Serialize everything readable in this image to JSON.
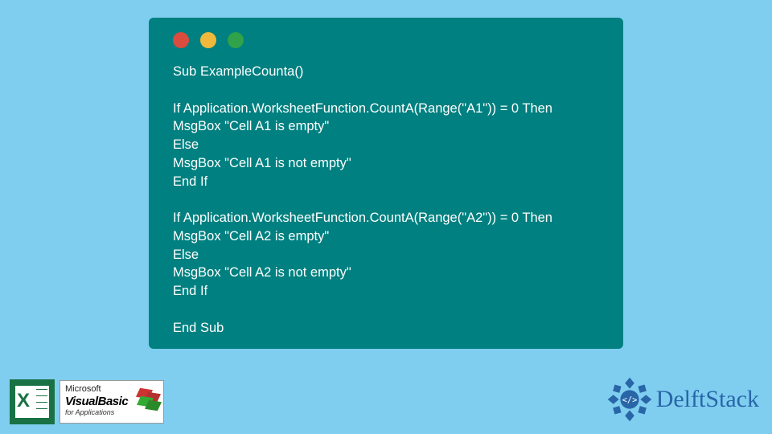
{
  "code": {
    "lines": [
      "Sub ExampleCounta()",
      "",
      "If Application.WorksheetFunction.CountA(Range(\"A1\")) = 0 Then",
      "MsgBox \"Cell A1 is empty\"",
      "Else",
      "MsgBox \"Cell A1 is not empty\"",
      "End If",
      "",
      "If Application.WorksheetFunction.CountA(Range(\"A2\")) = 0 Then",
      "MsgBox \"Cell A2 is empty\"",
      "Else",
      "MsgBox \"Cell A2 is not empty\"",
      "End If",
      "",
      "End Sub"
    ]
  },
  "vb_badge": {
    "line1": "Microsoft",
    "line2": "VisualBasic",
    "line3": "for Applications"
  },
  "brand": {
    "name": "DelftStack"
  },
  "colors": {
    "background": "#7fcef0",
    "window": "#008080",
    "brand": "#2866a8",
    "excel": "#1a7144"
  }
}
